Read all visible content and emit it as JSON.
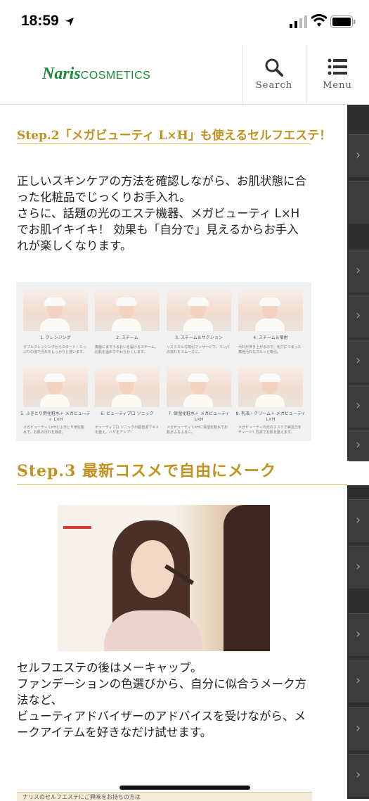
{
  "status": {
    "time": "18:59"
  },
  "header": {
    "logo_naris": "Naris",
    "logo_cosmetics": "COSMETICS",
    "search_label": "Search",
    "menu_label": "Menu"
  },
  "step2": {
    "heading": "Step.2「メガビューティ L×H」も使えるセルフエステ！",
    "paragraph_lines": [
      "正しいスキンケアの方法を確認しながら、お肌状態に合",
      "った化粧品でじっくりお手入れ。",
      "さらに、話題の光のエステ機器、メガビューティ L×H",
      "でお肌イキイキ！ 効果も「自分で」見えるからお手入",
      "れが楽しくなります。"
    ],
    "grid": [
      {
        "title": "1. クレンジング",
        "desc": "ダブルクレンジングからスタート！たっぷりの泡で汚れをしっかりと洗います。"
      },
      {
        "title": "2. スチーム",
        "desc": "角層にまでうるおいを届けるスチーム。お肌を温めてやわらかくします。"
      },
      {
        "title": "3. スチーム＆サクション",
        "desc": "リズミカルな吸引マッサージで、リンパの流れをスムーズに。"
      },
      {
        "title": "4. スチーム＆噴射",
        "desc": "汚れが浮き上がるので、毛穴につまった角栓汚れもスルッと吸引。"
      },
      {
        "title": "5. ふきとり用化粧水＋ メガビューティ L×H",
        "desc": "メガビューティ L×Hとふきとり用化粧水で、お肌の汚れを除去。"
      },
      {
        "title": "6. ビューティプロ ソニック",
        "desc": "ビューティプロ ソニックの超音波でキメを整え、ハリをアップ！"
      },
      {
        "title": "7. 保湿化粧水＋ メガビューティ L×H",
        "desc": "メガビューティ L×Hに保湿化粧水でお肌がふるふるに。"
      },
      {
        "title": "8. 乳液・クリーム＋ メガビューティ L×H",
        "desc": "メガビューティの光のエステで美活力をチャージ！乳液でお肌を整えます。"
      }
    ]
  },
  "step3": {
    "heading": "Step.3 最新コスメで自由にメーク",
    "paragraph_lines": [
      "セルフエステの後はメーキャップ。",
      "ファンデーションの色選びから、自分に似合うメーク方",
      "法など、",
      "ビューティアドバイザーのアドバイスを受けながら、メ",
      "ークアイテムを好きなだけ試せます。"
    ]
  },
  "banner": {
    "text": "ナリスのセルフエステにご興味をお持ちの方は"
  },
  "icons": {
    "search": "search-icon",
    "menu": "hamburger-menu-icon",
    "chevron": "chevron-right-icon"
  },
  "colors": {
    "brand_green": "#1d8a3a",
    "heading_gold": "#c0921f",
    "sidebar_dark": "#2e2e2e"
  }
}
